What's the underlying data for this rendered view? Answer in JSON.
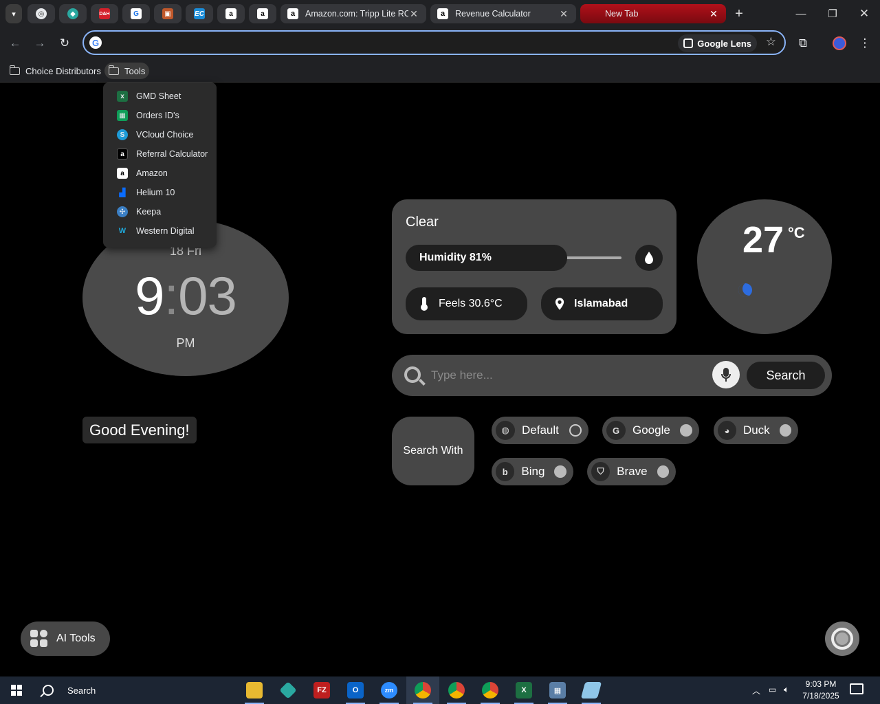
{
  "browser": {
    "tabs": [
      {
        "title": "Amazon.com: Tripp Lite RCA",
        "favicon": "amazon-favicon"
      },
      {
        "title": "Revenue Calculator",
        "favicon": "amazon-favicon"
      },
      {
        "title": "New Tab",
        "favicon": "newtab-favicon",
        "active": true
      }
    ],
    "pinned_tabs": [
      "tab-search-icon",
      "target-icon",
      "hex-icon",
      "dh-icon",
      "g-icon",
      "box-icon",
      "ec-icon",
      "amazon-icon",
      "amazon-icon"
    ],
    "new_tab_symbol": "+",
    "close_symbol": "✕",
    "omnibox": {
      "value": "",
      "lens_label": "Google Lens"
    },
    "bookmarks": [
      {
        "label": "Choice Distributors"
      },
      {
        "label": "Tools"
      }
    ],
    "tools_menu": [
      {
        "label": "GMD Sheet",
        "icon": "excel-icon",
        "color": "#1d6f42"
      },
      {
        "label": "Orders ID's",
        "icon": "sheets-icon",
        "color": "#0f9d58"
      },
      {
        "label": "VCloud Choice",
        "icon": "vcloud-icon",
        "color": "#1e9bd7"
      },
      {
        "label": "Referral Calculator",
        "icon": "amazon-icon",
        "color": "#000000"
      },
      {
        "label": "Amazon",
        "icon": "amazon-icon",
        "color": "#ffffff"
      },
      {
        "label": "Helium 10",
        "icon": "helium10-icon",
        "color": "#0a6cff"
      },
      {
        "label": "Keepa",
        "icon": "keepa-icon",
        "color": "#3b7fc4"
      },
      {
        "label": "Western Digital",
        "icon": "wd-icon",
        "color": "#1fa7d8"
      }
    ]
  },
  "page": {
    "clock": {
      "date": "18 Fri",
      "hour": "9",
      "colon": ":",
      "minutes": "03",
      "ampm": "PM"
    },
    "greeting": "Good Evening!",
    "weather": {
      "condition": "Clear",
      "humidity_label": "Humidity 81%",
      "humidity": 81,
      "feels": "Feels 30.6°C",
      "location": "Islamabad",
      "temp": "27",
      "unit": "°C"
    },
    "search": {
      "placeholder": "Type here...",
      "button": "Search"
    },
    "search_with": {
      "label": "Search With",
      "engines": [
        {
          "label": "Default",
          "selected": true
        },
        {
          "label": "Google",
          "selected": false
        },
        {
          "label": "Duck",
          "selected": false
        },
        {
          "label": "Bing",
          "selected": false
        },
        {
          "label": "Brave",
          "selected": false
        }
      ]
    },
    "ai_tools": "AI Tools"
  },
  "taskbar": {
    "search_label": "Search",
    "time": "9:03 PM",
    "date": "7/18/2025",
    "apps": [
      "file-explorer-icon",
      "hex-app-icon",
      "filezilla-icon",
      "outlook-icon",
      "zoom-icon",
      "chrome-icon",
      "chrome-icon",
      "chrome-icon",
      "excel-icon",
      "calculator-icon",
      "notepad-icon"
    ]
  },
  "colors": {
    "accent": "#8ab4f8",
    "active_tab": "#b0101a",
    "card": "#474747",
    "page_bg": "#000000"
  }
}
